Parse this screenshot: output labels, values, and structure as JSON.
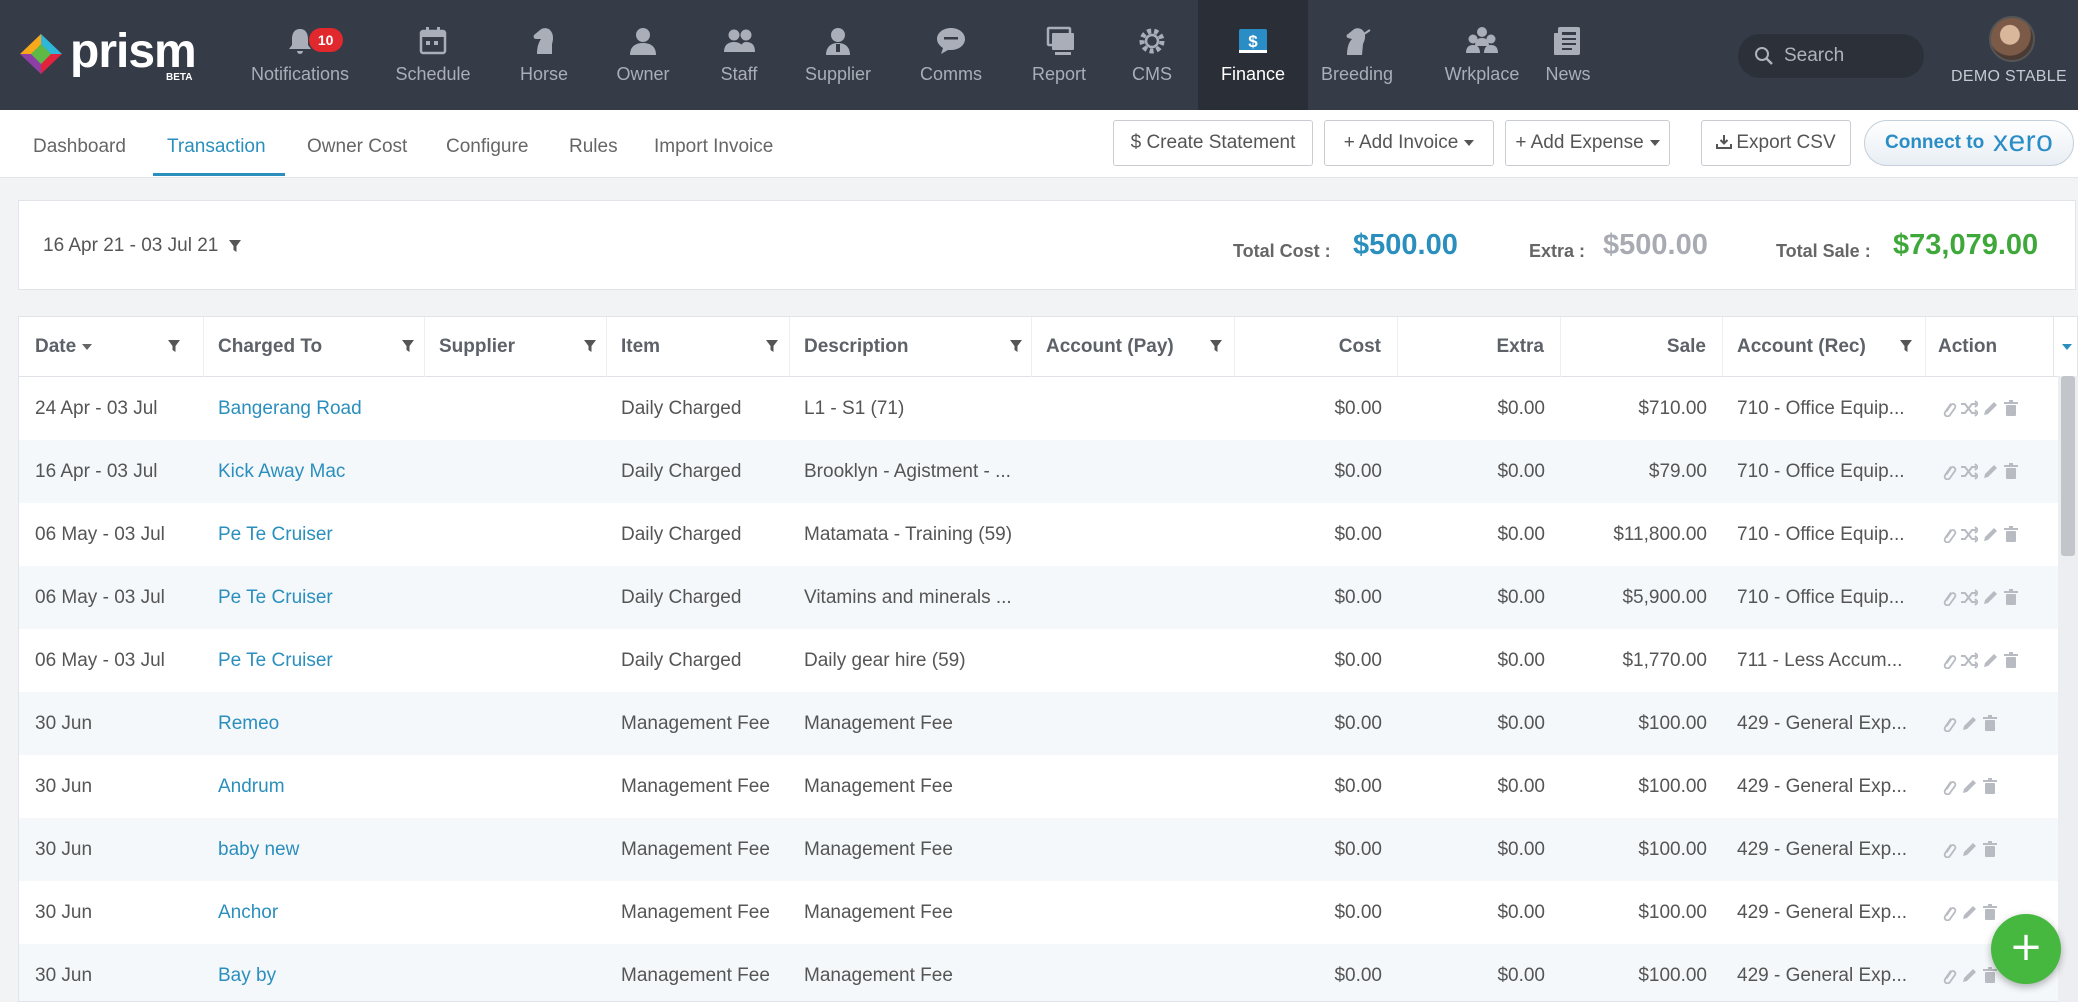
{
  "brand": {
    "name": "prism",
    "badge": "BETA"
  },
  "nav": {
    "items": [
      {
        "label": "Notifications",
        "icon": "bell-icon",
        "badge": "10",
        "active": false
      },
      {
        "label": "Schedule",
        "icon": "calendar-icon",
        "active": false
      },
      {
        "label": "Horse",
        "icon": "horse-icon",
        "active": false
      },
      {
        "label": "Owner",
        "icon": "owner-icon",
        "active": false
      },
      {
        "label": "Staff",
        "icon": "staff-icon",
        "active": false
      },
      {
        "label": "Supplier",
        "icon": "supplier-icon",
        "active": false
      },
      {
        "label": "Comms",
        "icon": "chat-icon",
        "active": false
      },
      {
        "label": "Report",
        "icon": "report-icon",
        "active": false
      },
      {
        "label": "CMS",
        "icon": "gear-icon",
        "active": false
      },
      {
        "label": "Finance",
        "icon": "dollar-icon",
        "active": true
      },
      {
        "label": "Breeding",
        "icon": "breeding-icon",
        "active": false
      },
      {
        "label": "Wrkplace",
        "icon": "workplace-icon",
        "active": false
      },
      {
        "label": "News",
        "icon": "news-icon",
        "active": false
      }
    ],
    "search_placeholder": "Search",
    "stable_name": "DEMO STABLE"
  },
  "subnav": {
    "tabs": [
      {
        "label": "Dashboard",
        "active": false
      },
      {
        "label": "Transaction",
        "active": true
      },
      {
        "label": "Owner Cost",
        "active": false
      },
      {
        "label": "Configure",
        "active": false
      },
      {
        "label": "Rules",
        "active": false
      },
      {
        "label": "Import Invoice",
        "active": false
      }
    ],
    "buttons": {
      "create_statement": "$ Create Statement",
      "add_invoice": "+ Add Invoice",
      "add_expense": "+ Add Expense",
      "export_csv": "Export CSV",
      "connect_to": "Connect to",
      "xero": "xero"
    }
  },
  "summary": {
    "date_range": "16 Apr 21 - 03 Jul 21",
    "total_cost_label": "Total Cost :",
    "total_cost": "$500.00",
    "extra_label": "Extra :",
    "extra": "$500.00",
    "total_sale_label": "Total Sale :",
    "total_sale": "$73,079.00",
    "colors": {
      "cost": "#2a8fbd",
      "extra": "#a8acb2",
      "sale": "#3fa83a"
    }
  },
  "table": {
    "columns": {
      "date": "Date",
      "charged_to": "Charged To",
      "supplier": "Supplier",
      "item": "Item",
      "description": "Description",
      "account_pay": "Account (Pay)",
      "cost": "Cost",
      "extra": "Extra",
      "sale": "Sale",
      "account_rec": "Account (Rec)",
      "action": "Action"
    },
    "rows": [
      {
        "date": "24 Apr - 03 Jul",
        "charged_to": "Bangerang Road",
        "supplier": "",
        "item": "Daily Charged",
        "description": "L1 - S1 (71)",
        "account_pay": "",
        "cost": "$0.00",
        "extra": "$0.00",
        "sale": "$710.00",
        "account_rec": "710 - Office Equip...",
        "type": "daily"
      },
      {
        "date": "16 Apr - 03 Jul",
        "charged_to": "Kick Away Mac",
        "supplier": "",
        "item": "Daily Charged",
        "description": "Brooklyn - Agistment - ...",
        "account_pay": "",
        "cost": "$0.00",
        "extra": "$0.00",
        "sale": "$79.00",
        "account_rec": "710 - Office Equip...",
        "type": "daily"
      },
      {
        "date": "06 May - 03 Jul",
        "charged_to": "Pe Te Cruiser",
        "supplier": "",
        "item": "Daily Charged",
        "description": "Matamata - Training (59)",
        "account_pay": "",
        "cost": "$0.00",
        "extra": "$0.00",
        "sale": "$11,800.00",
        "account_rec": "710 - Office Equip...",
        "type": "daily"
      },
      {
        "date": "06 May - 03 Jul",
        "charged_to": "Pe Te Cruiser",
        "supplier": "",
        "item": "Daily Charged",
        "description": "Vitamins and minerals ...",
        "account_pay": "",
        "cost": "$0.00",
        "extra": "$0.00",
        "sale": "$5,900.00",
        "account_rec": "710 - Office Equip...",
        "type": "daily"
      },
      {
        "date": "06 May - 03 Jul",
        "charged_to": "Pe Te Cruiser",
        "supplier": "",
        "item": "Daily Charged",
        "description": "Daily gear hire (59)",
        "account_pay": "",
        "cost": "$0.00",
        "extra": "$0.00",
        "sale": "$1,770.00",
        "account_rec": "711 - Less Accum...",
        "type": "daily"
      },
      {
        "date": "30 Jun",
        "charged_to": "Remeo",
        "supplier": "",
        "item": "Management Fee",
        "description": "Management Fee",
        "account_pay": "",
        "cost": "$0.00",
        "extra": "$0.00",
        "sale": "$100.00",
        "account_rec": "429 - General Exp...",
        "type": "fee"
      },
      {
        "date": "30 Jun",
        "charged_to": "Andrum",
        "supplier": "",
        "item": "Management Fee",
        "description": "Management Fee",
        "account_pay": "",
        "cost": "$0.00",
        "extra": "$0.00",
        "sale": "$100.00",
        "account_rec": "429 - General Exp...",
        "type": "fee"
      },
      {
        "date": "30 Jun",
        "charged_to": "baby new",
        "supplier": "",
        "item": "Management Fee",
        "description": "Management Fee",
        "account_pay": "",
        "cost": "$0.00",
        "extra": "$0.00",
        "sale": "$100.00",
        "account_rec": "429 - General Exp...",
        "type": "fee"
      },
      {
        "date": "30 Jun",
        "charged_to": "Anchor",
        "supplier": "",
        "item": "Management Fee",
        "description": "Management Fee",
        "account_pay": "",
        "cost": "$0.00",
        "extra": "$0.00",
        "sale": "$100.00",
        "account_rec": "429 - General Exp...",
        "type": "fee"
      },
      {
        "date": "30 Jun",
        "charged_to": "Bay by",
        "supplier": "",
        "item": "Management Fee",
        "description": "Management Fee",
        "account_pay": "",
        "cost": "$0.00",
        "extra": "$0.00",
        "sale": "$100.00",
        "account_rec": "429 - General Exp...",
        "type": "fee"
      }
    ]
  },
  "fab": {
    "label": "+"
  }
}
